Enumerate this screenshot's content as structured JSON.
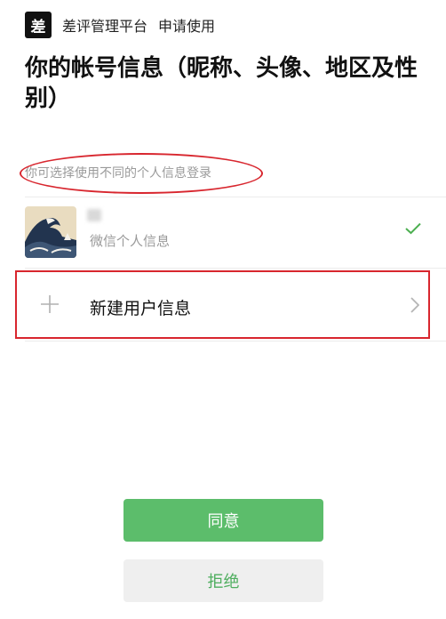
{
  "header": {
    "logo_char": "差",
    "app_name": "差评管理平台",
    "request_label": "申请使用"
  },
  "title": "你的帐号信息（昵称、头像、地区及性别）",
  "hint": "你可选择使用不同的个人信息登录",
  "profile_option": {
    "label": "微信个人信息",
    "selected": true,
    "check_color": "#4caf50"
  },
  "new_user_option": {
    "label": "新建用户信息"
  },
  "buttons": {
    "agree": "同意",
    "reject": "拒绝"
  },
  "colors": {
    "accent": "#5cbd6b",
    "annotation": "#d8262e"
  }
}
